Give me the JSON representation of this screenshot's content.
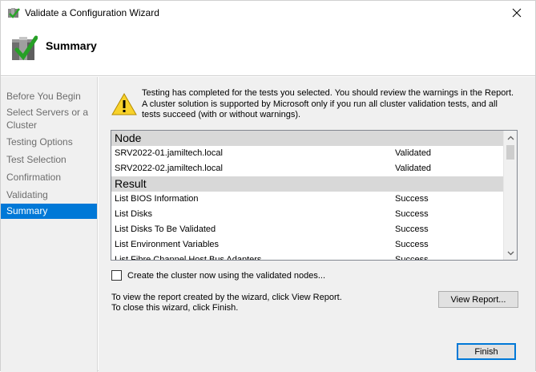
{
  "window": {
    "title": "Validate a Configuration Wizard",
    "close_icon": "close-icon"
  },
  "header": {
    "title": "Summary",
    "icon": "cluster-servers-checkmark-icon"
  },
  "nav": {
    "items": [
      {
        "label": "Before You Begin",
        "active": false
      },
      {
        "label": "Select Servers or a Cluster",
        "active": false
      },
      {
        "label": "Testing Options",
        "active": false
      },
      {
        "label": "Test Selection",
        "active": false
      },
      {
        "label": "Confirmation",
        "active": false
      },
      {
        "label": "Validating",
        "active": false
      },
      {
        "label": "Summary",
        "active": true
      }
    ]
  },
  "content": {
    "warning_icon": "warning-icon",
    "warning_text": "Testing has completed for the tests you selected. You should review the warnings in the Report.  A cluster solution is supported by Microsoft only if you run all cluster validation tests, and all tests succeed (with or without warnings).",
    "list": {
      "groups": [
        {
          "header": "Node",
          "rows": [
            {
              "name": "SRV2022-01.jamiltech.local",
              "status": "Validated"
            },
            {
              "name": "SRV2022-02.jamiltech.local",
              "status": "Validated"
            }
          ]
        },
        {
          "header": "Result",
          "rows": [
            {
              "name": "List BIOS Information",
              "status": "Success"
            },
            {
              "name": "List Disks",
              "status": "Success"
            },
            {
              "name": "List Disks To Be Validated",
              "status": "Success"
            },
            {
              "name": "List Environment Variables",
              "status": "Success"
            },
            {
              "name": "List Fibre Channel Host Bus Adapters",
              "status": "Success"
            }
          ]
        }
      ]
    },
    "checkbox": {
      "label": "Create the cluster now using the validated nodes...",
      "checked": false
    },
    "info_line1": "To view the report created by the wizard, click View Report.",
    "info_line2": "To close this wizard, click Finish.",
    "view_report_label": "View Report...",
    "finish_label": "Finish"
  },
  "colors": {
    "accent": "#0078d7",
    "panel_bg": "#f0f0f0",
    "group_header_bg": "#d8d8d8"
  }
}
